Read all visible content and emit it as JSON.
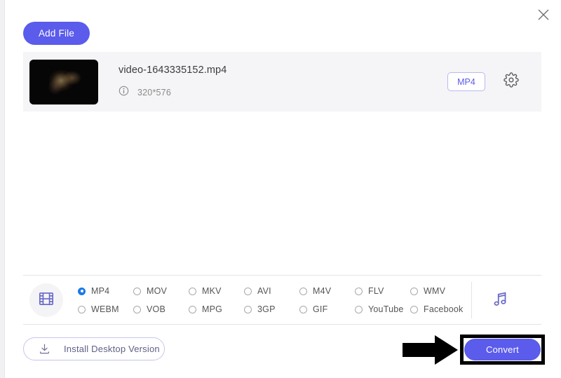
{
  "window": {
    "close_label": "×"
  },
  "toolbar": {
    "add_file_label": "Add File"
  },
  "file_row": {
    "name": "video-1643335152.mp4",
    "resolution": "320*576",
    "format_badge": "MP4",
    "info_icon": "info-circle-icon",
    "gear_icon": "gear-icon",
    "thumbnail_alt": "video-thumbnail"
  },
  "format_panel": {
    "category_icon": "film-strip-icon",
    "audio_icon": "music-note-icon",
    "selected": "MP4",
    "options": [
      {
        "label": "MP4",
        "selected": true
      },
      {
        "label": "MOV",
        "selected": false
      },
      {
        "label": "MKV",
        "selected": false
      },
      {
        "label": "AVI",
        "selected": false
      },
      {
        "label": "M4V",
        "selected": false
      },
      {
        "label": "FLV",
        "selected": false
      },
      {
        "label": "WMV",
        "selected": false
      },
      {
        "label": "WEBM",
        "selected": false
      },
      {
        "label": "VOB",
        "selected": false
      },
      {
        "label": "MPG",
        "selected": false
      },
      {
        "label": "3GP",
        "selected": false
      },
      {
        "label": "GIF",
        "selected": false
      },
      {
        "label": "YouTube",
        "selected": false
      },
      {
        "label": "Facebook",
        "selected": false
      }
    ]
  },
  "footer": {
    "install_label": "Install Desktop Version",
    "install_icon": "download-icon",
    "convert_label": "Convert"
  },
  "colors": {
    "accent": "#5b5bec",
    "accent_light": "#b9b9f0",
    "radio_selected": "#1a7ae8",
    "row_bg": "#f5f5f7",
    "divider": "#e3e3e6",
    "annotation": "#000000"
  }
}
